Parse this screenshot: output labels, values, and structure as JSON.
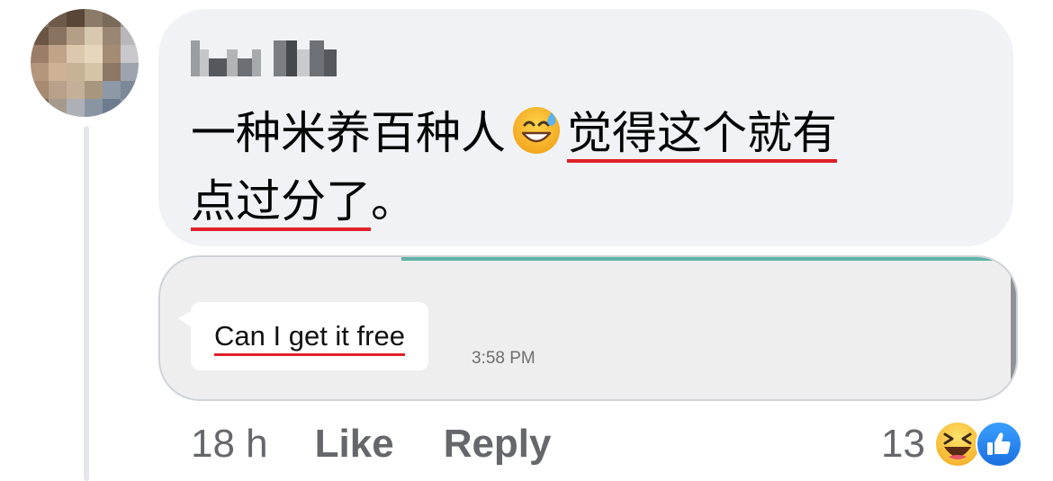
{
  "comment": {
    "author_name": "L■■ D■■",
    "text_part1": "一种米养百种人",
    "emoji": "sweat-smile-emoji",
    "text_underlined_a": "觉得这个就有",
    "text_underlined_b": "点过分了",
    "text_end": "。",
    "underline_color": "#e0202a"
  },
  "attachment": {
    "message_text": "Can I get it free",
    "message_time": "3:58 PM",
    "accent_color": "#5fb3a4"
  },
  "actions": {
    "time_ago": "18 h",
    "like_label": "Like",
    "reply_label": "Reply"
  },
  "reactions": {
    "count": "13",
    "icons": [
      "haha-reaction-icon",
      "like-reaction-icon"
    ]
  },
  "colors": {
    "bubble_bg": "#f0f2f5",
    "secondary_text": "#65676b",
    "like_blue": "#1b74e4"
  }
}
